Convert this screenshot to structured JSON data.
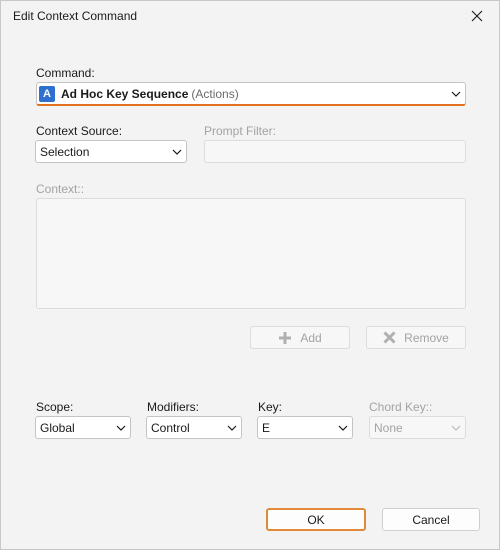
{
  "window": {
    "title": "Edit Context Command"
  },
  "command": {
    "label": "Command:",
    "badge": "A",
    "name": "Ad Hoc Key Sequence",
    "category": "(Actions)"
  },
  "context_source": {
    "label": "Context Source:",
    "value": "Selection"
  },
  "prompt_filter": {
    "label": "Prompt Filter:",
    "value": ""
  },
  "context": {
    "label": "Context::"
  },
  "buttons": {
    "add": "Add",
    "remove": "Remove",
    "ok": "OK",
    "cancel": "Cancel"
  },
  "scope": {
    "label": "Scope:",
    "value": "Global"
  },
  "modifiers": {
    "label": "Modifiers:",
    "value": "Control"
  },
  "key": {
    "label": "Key:",
    "value": "E"
  },
  "chord_key": {
    "label": "Chord Key::",
    "value": "None"
  },
  "colors": {
    "accent": "#e2701c",
    "badge": "#2f6fcf",
    "disabled_text": "#a3a3a3"
  },
  "icons": {
    "close": "close-icon",
    "chevron": "chevron-down-icon",
    "add": "plus-icon",
    "remove": "x-icon"
  }
}
